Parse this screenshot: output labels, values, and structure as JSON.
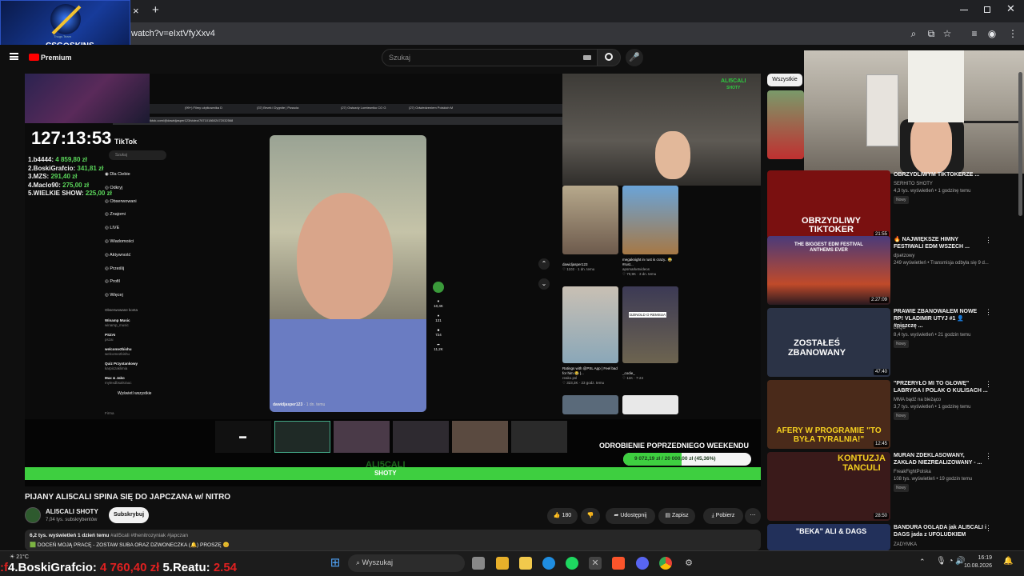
{
  "browser": {
    "url": "watch?v=eIxtVfyXxv4",
    "new_tab_glyph": "+",
    "close_tab_glyph": "×"
  },
  "overlay_logo": {
    "text": "CSG⊙SKINS",
    "caption": "Thugs Team"
  },
  "youtube": {
    "premium_label": "Premium",
    "search_placeholder": "Szukaj"
  },
  "stream": {
    "timer": "127:13:53",
    "leaderboard": [
      {
        "name": "1.b4444:",
        "amount": "4 859,80 zł"
      },
      {
        "name": "2.BoskiGrafcio:",
        "amount": "341,81 zł"
      },
      {
        "name": "3.MZS:",
        "amount": "291,40 zł"
      },
      {
        "name": "4.Maclo90:",
        "amount": "275,00 zł"
      },
      {
        "name": "5.WIELKIE SHOW:",
        "amount": "225,00 zł"
      }
    ],
    "inner_url": "tiktok.com/@dawidjasper123/video/7671018602472032568",
    "inner_tabs": [
      "(99+) Filmy użytkownika D",
      "(37) Brvek i Dygnite | Pusscia",
      "(27) Gwiazdy Lomtewriko CO G",
      "(27) Odwiedzeniem Polskich M"
    ],
    "tiktok_brand": "TikTok",
    "tiktok_search": "Szukaj",
    "tiktok_menu": [
      "Dla Ciebie",
      "Odkryj",
      "Obserwowani",
      "Znajomi",
      "LIVE",
      "Wiadomości",
      "Aktywność",
      "Prześlij",
      "Profil",
      "Więcej"
    ],
    "followed_header": "Obserwowane konta",
    "followed": [
      {
        "name": "Winamp Music",
        "handle": "winamp_music"
      },
      {
        "name": "PSZAI",
        "handle": "pszai"
      },
      {
        "name": "welcome2bishu",
        "handle": "welcome2bishu"
      },
      {
        "name": "Quiz Przystankowy",
        "handle": "karpiczaklimia"
      },
      {
        "name": "Max & Jako",
        "handle": "mylexdbsalsrauc"
      }
    ],
    "show_all": "Wyświetl wszystkie",
    "firma": "Firma",
    "video_user": "dawidjasper123",
    "video_user_meta": "· 1 dn. temu",
    "actions": [
      "10,4K",
      "131",
      "724",
      "11,2K"
    ],
    "cam_watermark": "ALI5CALI",
    "cam_watermark_sub": "SHOTY",
    "grid": [
      {
        "user": "dawidjasper123",
        "meta": "♡ 1102 · 1 dn. temu"
      },
      {
        "title": "megaknight in rust is crazy.. 😂 #rust...",
        "user": "apsmarketvideos",
        "meta": "♡ 70,9K · 3 dn. temu"
      },
      {
        "title": "Ratings with @PSL App | Feel bad for him 😂 |...",
        "user": "reako.psl",
        "meta": "♡ 323,3K · 23 godz. temu"
      },
      {
        "title": "_codie_",
        "meta": "♡ 11K · 7-24"
      }
    ],
    "grid_label": "DZINOLD O REMSUA",
    "on_air_label": "NA ŻYWO",
    "goal_title": "ODROBIENIE POPRZEDNIEGO WEEKENDU",
    "goal_text": "9 072,19 zł / 20 000,00 zł (45,36%)",
    "goal_percent": 45.36,
    "brand_bar": "ALI5CALI",
    "brand_bar_sub": "SHOTY"
  },
  "video": {
    "title": "PIJANY ALI5CALI SPINA SIĘ DO JAPCZANA w/ NITRO",
    "channel": "ALI5CALI SHOTY",
    "subs": "7,04 tys. subskrybentów",
    "subscribe": "Subskrybuj",
    "likes": "180",
    "share": "Udostępnij",
    "save": "Zapisz",
    "download": "Pobierz",
    "desc_meta": "6,2 tys. wyświetleń  1 dzień temu",
    "desc_tags": "#ali5cali #thenitrozyniak #japczan",
    "desc_line": "🟩 DOCEŃ MOJĄ PRACĘ - ZOSTAW SUBA ORAZ DZWONECZKA (🔔) PROSZĘ 😊"
  },
  "sidebar": {
    "chip": "Wszystkie",
    "items": [
      {
        "title": "OBRZYDLIWYM TIKTOKERZE ...",
        "channel": "SERHITO SHOTY",
        "meta": "4,3 tys. wyświetleń • 1 godzinę temu",
        "badge": "Nowy",
        "dur": "21:55",
        "thumb_text": "OBRZYDLIWY TIKTOKER",
        "color": "#7a1010"
      },
      {
        "title": "🔥 NAJWIĘKSZE HIMNY FESTIWALI EDM WSZECH ...",
        "channel": "djsetzowy",
        "meta": "249 wyświetleń • Transmisja odbyła się 9 d...",
        "badge": "",
        "dur": "2:27:09",
        "thumb_text": "THE BIGGEST EDM FESTIVAL ANTHEMS EVER",
        "color": "#3a2a66"
      },
      {
        "title": "PRAWIE ZBANOWAŁEM NOWE RP! VLADIMIR UTYJ #1 👤 #niszczę ...",
        "channel": "LeQu",
        "meta": "8,4 tys. wyświetleń • 21 godzin temu",
        "badge": "Nowy",
        "dur": "47:40",
        "thumb_text": "ZOSTAŁEŚ ZBANOWANY",
        "color": "#2b3346"
      },
      {
        "title": "\"PRZERYŁO MI TO GŁOWĘ\" LABRYGA I POLAK O KULISACH ...",
        "channel": "MMA bądź na bieżąco",
        "meta": "3,7 tys. wyświetleń • 1 godzinę temu",
        "badge": "Nowy",
        "dur": "12:45",
        "thumb_text": "AFERY W PROGRAMIE \"TO BYŁA TYRALNIA!\"",
        "color": "#4a2a1a"
      },
      {
        "title": "MURAN ZDEKLASOWANY, ZAKŁAD NIEZREALIZOWANY - ...",
        "channel": "FreakFightPolska",
        "meta": "108 tys. wyświetleń • 19 godzin temu",
        "badge": "Nowy",
        "dur": "28:50",
        "thumb_text": "KONTUZJA TANCULI",
        "color": "#3a1a1a"
      },
      {
        "title": "BANDURA OGLĄDA jak ALI5CALI i DAGS jada z UFOLUDKIEM",
        "channel": "ZADYMKA",
        "meta": "",
        "badge": "",
        "dur": "",
        "thumb_text": "\"BEKA\" ALI & DAGS",
        "color": "#22305a"
      }
    ]
  },
  "taskbar": {
    "weather": "21°C",
    "search": "Wyszukaj",
    "ticker_left": "4.BoskiGrafcio:",
    "ticker_left_val": "4 760,40 zł",
    "ticker_right": "5.Reatu:",
    "ticker_right_val": "2.54",
    "time": "16:19",
    "date": "10.08.2026"
  }
}
